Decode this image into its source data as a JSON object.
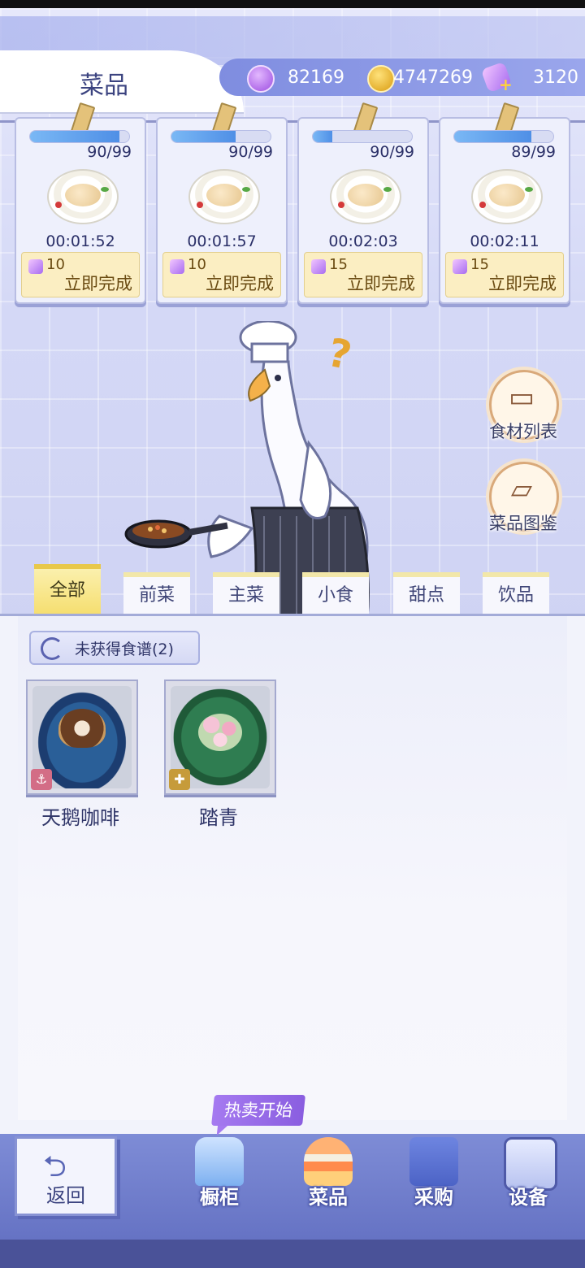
{
  "header": {
    "title": "菜品",
    "resources": [
      {
        "icon": "purple-gem-icon",
        "value": "82169"
      },
      {
        "icon": "gold-coin-icon",
        "value": "4747269"
      },
      {
        "icon": "feather-plus-icon",
        "value": "3120"
      }
    ]
  },
  "cooking_slots": [
    {
      "count": "90/99",
      "progress": 0.9,
      "timer": "00:01:52",
      "cost": "10",
      "action": "立即完成"
    },
    {
      "count": "90/99",
      "progress": 0.65,
      "timer": "00:01:57",
      "cost": "10",
      "action": "立即完成"
    },
    {
      "count": "90/99",
      "progress": 0.2,
      "timer": "00:02:03",
      "cost": "15",
      "action": "立即完成"
    },
    {
      "count": "89/99",
      "progress": 0.78,
      "timer": "00:02:11",
      "cost": "15",
      "action": "立即完成"
    }
  ],
  "side_buttons": [
    {
      "label": "食材列表",
      "icon": "box-icon"
    },
    {
      "label": "菜品图鉴",
      "icon": "dish-cloche-icon"
    }
  ],
  "tabs": [
    {
      "label": "全部",
      "active": true
    },
    {
      "label": "前菜",
      "active": false
    },
    {
      "label": "主菜",
      "active": false
    },
    {
      "label": "小食",
      "active": false
    },
    {
      "label": "甜点",
      "active": false
    },
    {
      "label": "饮品",
      "active": false
    }
  ],
  "recipes": {
    "header": "未获得食谱(2)",
    "items": [
      {
        "name": "天鹅咖啡",
        "icon": "heart-coffee-icon",
        "badge": "anchor-icon"
      },
      {
        "name": "踏青",
        "icon": "flower-salad-icon",
        "badge": "puzzle-icon"
      }
    ]
  },
  "bottom_nav": {
    "back_label": "返回",
    "hot_badge": "热卖开始",
    "items": [
      {
        "label": "橱柜",
        "icon": "cabinet-drink-icon"
      },
      {
        "label": "菜品",
        "icon": "burger-icon"
      },
      {
        "label": "采购",
        "icon": "shopping-bag-icon"
      },
      {
        "label": "设备",
        "icon": "espresso-machine-icon"
      }
    ]
  }
}
